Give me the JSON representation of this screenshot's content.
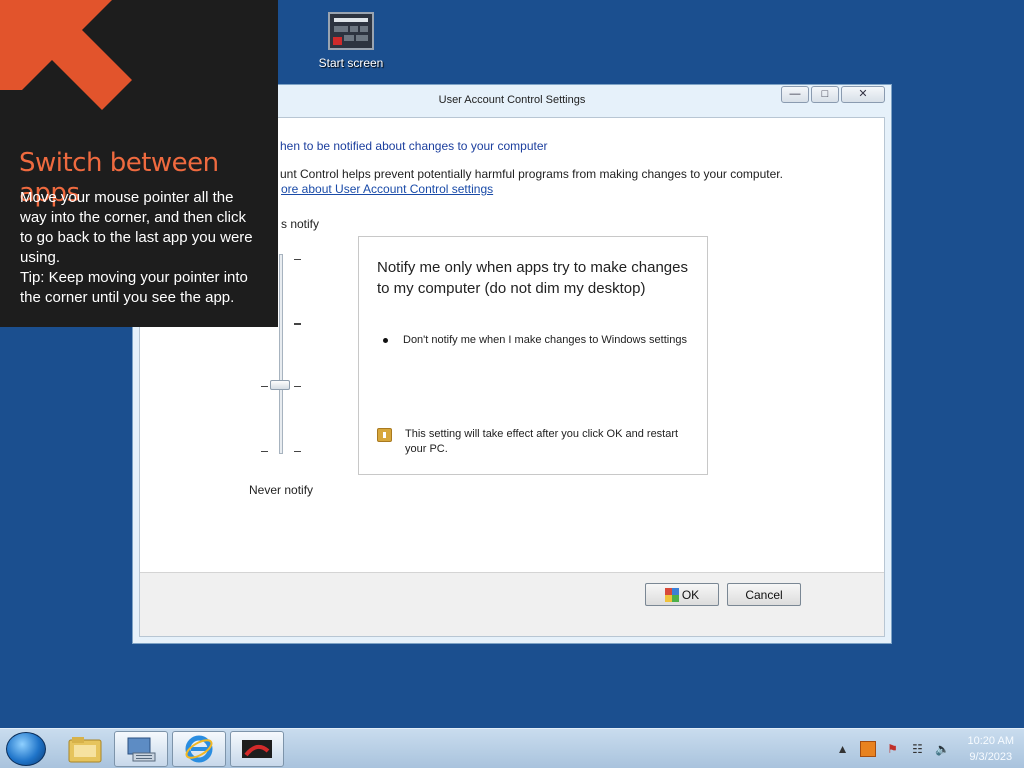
{
  "desktop": {
    "icons": [
      {
        "label": "Start screen",
        "icon": "start-screen-icon"
      }
    ]
  },
  "window": {
    "title": "User Account Control Settings",
    "controls": {
      "minimize": "minimize-icon",
      "maximize": "maximize-icon",
      "close": "close-icon"
    },
    "heading": "hen to be notified about changes to your computer",
    "description": "unt Control helps prevent potentially harmful programs from making changes to your computer.",
    "learn_more_link": "ore about User Account Control settings",
    "slider": {
      "top_label": "s notify",
      "bottom_label": "Never notify",
      "levels": 4,
      "selected_level": 2
    },
    "info": {
      "title": "Notify me only when apps try to make changes to my computer (do not dim my desktop)",
      "bullet": "Don't notify me when I make changes to Windows settings",
      "note": "This setting will take effect after you click OK and restart your PC."
    },
    "buttons": {
      "ok": "OK",
      "cancel": "Cancel"
    }
  },
  "charm_tip": {
    "title": "Switch between apps",
    "body_line1": "Move your mouse pointer all the way into the corner, and then click to go back to the last app you were using.",
    "body_line2": "Tip: Keep moving your pointer into the corner until you see the app.",
    "accent_color": "#ef6a3f"
  },
  "taskbar": {
    "items": [
      "start-orb",
      "file-explorer-icon",
      "control-panel-icon",
      "internet-explorer-icon",
      "media-app-icon"
    ],
    "tray_icons": [
      "show-hidden-icons-icon",
      "java-update-icon",
      "action-center-flag-icon",
      "network-icon",
      "volume-icon"
    ],
    "clock": {
      "time": "10:20 AM",
      "date": "9/3/2023"
    }
  }
}
